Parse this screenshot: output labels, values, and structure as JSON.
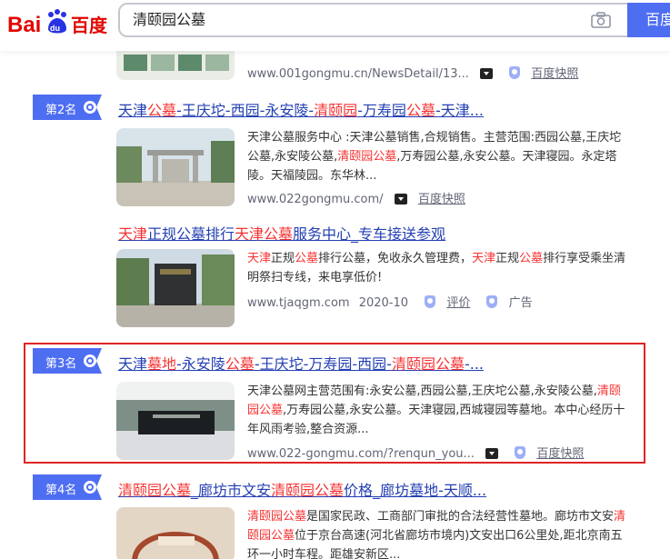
{
  "header": {
    "logo": "Bai百度",
    "search_query": "清颐园公墓",
    "search_button": "百度"
  },
  "results": [
    {
      "meta_url": "www.001gongmu.cn/NewsDetail/13...",
      "meta_label": "百度快照"
    },
    {
      "rank": "第2名",
      "title_parts": [
        "天津",
        "公墓",
        "-王庆坨-西园-永安陵-",
        "清颐园",
        "-万寿园",
        "公墓",
        "-天津..."
      ],
      "desc_parts": [
        "天津公墓服务中心 :天津公墓销售,合规销售。主营范围:西园公墓,王庆坨公墓,永安陵公墓,",
        "清颐园公墓",
        ",万寿园公墓,永安公墓。天津寝园。永定塔陵。天福陵园。东华林..."
      ],
      "meta_url": "www.022gongmu.com/",
      "meta_label": "百度快照"
    },
    {
      "title_parts": [
        "天津",
        "正规公墓排行",
        "天津公墓",
        "服务中心_专车接送参观"
      ],
      "desc_parts": [
        "天津",
        "正规",
        "公墓",
        "排行公墓，免收永久管理费，",
        "天津",
        "正规",
        "公墓",
        "排行享受乘坐清明祭扫专线，来电享低价!"
      ],
      "meta_url": "www.tjaqgm.com",
      "meta_date": "2020-10",
      "meta_review": "评价",
      "meta_ad": "广告"
    },
    {
      "rank": "第3名",
      "title_parts": [
        "天津",
        "墓地",
        "-永安陵",
        "公墓",
        "-王庆坨-万寿园-西园-",
        "清颐园公墓",
        "-..."
      ],
      "desc_parts": [
        "天津公墓网主营范围有:永安公墓,西园公墓,王庆坨公墓,永安陵公墓,",
        "清颐园公墓",
        ",万寿园公墓,永安公墓。天津寝园,西城寝园等墓地。本中心经历十年风雨考验,整合资源..."
      ],
      "meta_url": "www.022-gongmu.com/?renqun_you...",
      "meta_label": "百度快照"
    },
    {
      "rank": "第4名",
      "title_parts": [
        "清颐园公墓",
        "_廊坊市文安",
        "清颐园公墓",
        "价格",
        "_廊坊墓地-天顺..."
      ],
      "desc_parts": [
        "清颐园公墓",
        "是国家民政、工商部门审批的合法经营性墓地。廊坊市文安",
        "清颐园公墓",
        "位于京台高速(河北省廊坊市境内)文安出口6公里处,距北京南五环一小时车程。距雄安新区..."
      ]
    }
  ],
  "colors": {
    "link": "#2440b3",
    "highlight": "#f73131",
    "badge": "#4e6ef2",
    "frame": "#e02424"
  }
}
